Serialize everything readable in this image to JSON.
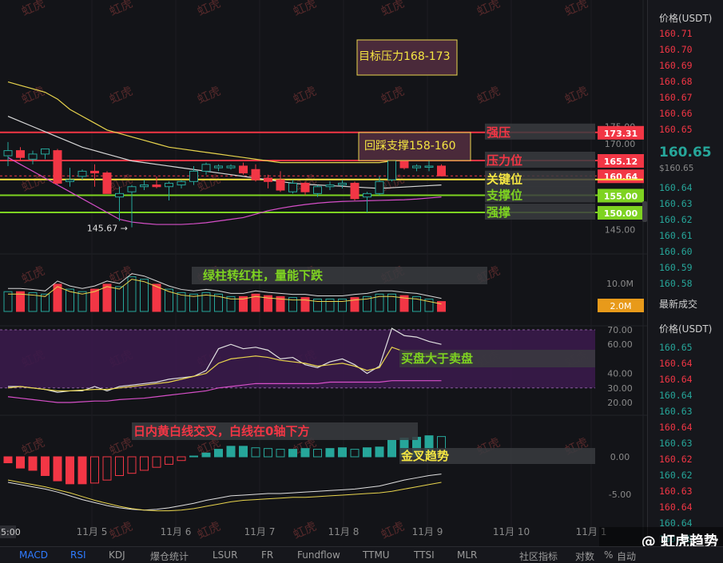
{
  "chart_data": {
    "type": "candlestick",
    "x_ticks": [
      "11月 5",
      "11月 6",
      "11月 7",
      "11月 8",
      "11月 9",
      "11月 10",
      "11月 1"
    ],
    "x_tick_first_partial": "5:00",
    "price_axis": {
      "ticks": [
        175.0,
        170.0,
        145.0
      ],
      "range": [
        140,
        180
      ]
    },
    "candles": [
      {
        "o": 166.5,
        "h": 170.5,
        "l": 163.5,
        "c": 168.0
      },
      {
        "o": 168.0,
        "h": 169.0,
        "l": 165.0,
        "c": 166.0
      },
      {
        "o": 165.5,
        "h": 168.0,
        "l": 164.0,
        "c": 167.0
      },
      {
        "o": 167.0,
        "h": 168.5,
        "l": 165.5,
        "c": 168.5
      },
      {
        "o": 168.0,
        "h": 168.5,
        "l": 158.0,
        "c": 158.5
      },
      {
        "o": 159.0,
        "h": 163.0,
        "l": 157.5,
        "c": 159.5
      },
      {
        "o": 160.5,
        "h": 162.5,
        "l": 159.5,
        "c": 162.0
      },
      {
        "o": 162.0,
        "h": 164.0,
        "l": 157.5,
        "c": 161.5
      },
      {
        "o": 161.5,
        "h": 162.0,
        "l": 155.5,
        "c": 155.5
      },
      {
        "o": 154.5,
        "h": 157.5,
        "l": 147.5,
        "c": 155.5
      },
      {
        "o": 156.0,
        "h": 158.0,
        "l": 145.67,
        "c": 157.5
      },
      {
        "o": 157.5,
        "h": 159.5,
        "l": 156.5,
        "c": 158.0
      },
      {
        "o": 158.0,
        "h": 160.5,
        "l": 157.0,
        "c": 157.5
      },
      {
        "o": 157.5,
        "h": 159.0,
        "l": 153.5,
        "c": 158.5
      },
      {
        "o": 158.0,
        "h": 159.5,
        "l": 157.0,
        "c": 159.0
      },
      {
        "o": 159.0,
        "h": 163.5,
        "l": 158.0,
        "c": 162.0
      },
      {
        "o": 162.0,
        "h": 164.5,
        "l": 161.0,
        "c": 164.0
      },
      {
        "o": 163.0,
        "h": 164.0,
        "l": 162.0,
        "c": 163.5
      },
      {
        "o": 163.0,
        "h": 164.0,
        "l": 162.5,
        "c": 163.5
      },
      {
        "o": 163.5,
        "h": 164.5,
        "l": 161.0,
        "c": 161.5
      },
      {
        "o": 162.5,
        "h": 164.0,
        "l": 159.0,
        "c": 159.5
      },
      {
        "o": 160.0,
        "h": 161.0,
        "l": 157.0,
        "c": 159.0
      },
      {
        "o": 159.5,
        "h": 162.0,
        "l": 156.0,
        "c": 156.5
      },
      {
        "o": 156.0,
        "h": 159.5,
        "l": 155.5,
        "c": 158.5
      },
      {
        "o": 158.5,
        "h": 159.0,
        "l": 155.0,
        "c": 156.0
      },
      {
        "o": 155.5,
        "h": 158.0,
        "l": 154.5,
        "c": 157.5
      },
      {
        "o": 157.5,
        "h": 159.0,
        "l": 156.5,
        "c": 158.0
      },
      {
        "o": 158.0,
        "h": 159.5,
        "l": 157.0,
        "c": 158.5
      },
      {
        "o": 158.5,
        "h": 159.0,
        "l": 153.5,
        "c": 154.0
      },
      {
        "o": 154.5,
        "h": 156.0,
        "l": 150.0,
        "c": 155.5
      },
      {
        "o": 155.5,
        "h": 160.5,
        "l": 155.0,
        "c": 159.0
      },
      {
        "o": 159.5,
        "h": 167.0,
        "l": 159.0,
        "c": 166.5
      },
      {
        "o": 166.5,
        "h": 167.5,
        "l": 162.5,
        "c": 163.0
      },
      {
        "o": 163.0,
        "h": 164.0,
        "l": 162.0,
        "c": 163.5
      },
      {
        "o": 163.5,
        "h": 165.5,
        "l": 162.0,
        "c": 163.5
      },
      {
        "o": 163.5,
        "h": 164.0,
        "l": 160.5,
        "c": 160.64
      }
    ],
    "ma_series": [
      {
        "color": "#e8d44d",
        "values": [
          188,
          187,
          186,
          185,
          183,
          180,
          178,
          176,
          174,
          173,
          172,
          171,
          170,
          169,
          168.5,
          168,
          167.5,
          167,
          166.5,
          166,
          165.5,
          165,
          164.5,
          164.5,
          164.5,
          164.5,
          164.5,
          164.5,
          164.5,
          164.5,
          164.5,
          165,
          165.5,
          166,
          166.5,
          166.8
        ]
      },
      {
        "color": "#d8d8d8",
        "values": [
          178,
          176.5,
          175,
          173.5,
          172,
          170.5,
          169,
          168,
          167,
          166,
          165,
          164.5,
          164,
          163.5,
          163,
          162.5,
          162,
          161.5,
          161,
          160.5,
          160,
          159.5,
          159,
          158.5,
          158.2,
          158,
          157.8,
          157.6,
          157.4,
          157.2,
          157,
          157.2,
          157.4,
          157.6,
          157.8,
          158
        ]
      },
      {
        "color": "#d64fc8",
        "values": [
          166,
          164,
          162,
          160,
          158,
          156,
          154,
          152,
          150,
          148,
          147.2,
          146.8,
          146.5,
          146.5,
          146.5,
          146.7,
          147,
          147.5,
          148,
          148.5,
          149.5,
          150.5,
          151.2,
          151.8,
          152.3,
          152.7,
          153,
          153.2,
          153.3,
          153.4,
          153.5,
          153.6,
          153.7,
          153.9,
          154.2,
          154.5
        ]
      }
    ],
    "volume": {
      "axis_label": "10.0M",
      "current_label": "2.0M",
      "values": [
        4,
        4,
        3.8,
        3.5,
        5.5,
        4.5,
        4,
        4.5,
        5.5,
        5,
        7,
        6.5,
        5.5,
        4.5,
        3.8,
        3.5,
        3.8,
        3.5,
        3,
        3,
        3.5,
        3.2,
        3,
        2.8,
        2.8,
        2.5,
        2.5,
        2.5,
        2.8,
        3,
        3.5,
        3.5,
        3.2,
        3,
        2.5,
        2
      ]
    },
    "rsi": {
      "ticks": [
        70.0,
        60.0,
        40.0,
        30.0,
        20.0
      ],
      "range": [
        10,
        80
      ],
      "line1": [
        31,
        31,
        30,
        29,
        27,
        28,
        28,
        31,
        28,
        31,
        32,
        33,
        34,
        36,
        37,
        38,
        42,
        57,
        60,
        57,
        58,
        56,
        50,
        51,
        46,
        44,
        48,
        50,
        46,
        40,
        45,
        71,
        66,
        65,
        62,
        60
      ],
      "line2": [
        30,
        31,
        30,
        29,
        28,
        28,
        28.5,
        29,
        29,
        30,
        31,
        32,
        33,
        34,
        36,
        38,
        40,
        47,
        50,
        51,
        52,
        51,
        49,
        48,
        47,
        45,
        46,
        47,
        45,
        42,
        44,
        58,
        55,
        54,
        53,
        52
      ],
      "line3": [
        24,
        23,
        22,
        21,
        20,
        20,
        20.5,
        21,
        21,
        22,
        22.5,
        23,
        24,
        25,
        26,
        27,
        28,
        30,
        31,
        32,
        33,
        33,
        33,
        33,
        33,
        33,
        34,
        34,
        34,
        34,
        34,
        35,
        35,
        35,
        35,
        35
      ]
    },
    "macd": {
      "ticks": [
        "0.00",
        "-5.00"
      ],
      "range": [
        -8,
        5
      ],
      "hist": [
        -0.8,
        -1.5,
        -1.8,
        -2.5,
        -3.2,
        -3.6,
        -3.6,
        -3.5,
        -3.1,
        -2.5,
        -2.2,
        -1.8,
        -1.4,
        -1.0,
        -0.5,
        0.1,
        0.5,
        1.0,
        1.4,
        1.4,
        1.2,
        1.1,
        1.0,
        1.0,
        1.1,
        1.0,
        1.1,
        1.2,
        1.0,
        1.2,
        1.3,
        2.2,
        2.5,
        2.6,
        2.8,
        2.7
      ],
      "dif": [
        -3.4,
        -3.7,
        -4.0,
        -4.3,
        -4.7,
        -5.2,
        -5.7,
        -6.1,
        -6.5,
        -6.8,
        -7.0,
        -7.1,
        -7.0,
        -6.8,
        -6.5,
        -6.2,
        -5.8,
        -5.5,
        -5.2,
        -5.1,
        -5.0,
        -4.9,
        -4.9,
        -4.8,
        -4.7,
        -4.6,
        -4.5,
        -4.4,
        -4.3,
        -4.1,
        -3.9,
        -3.5,
        -3.1,
        -2.8,
        -2.5,
        -2.3
      ],
      "dea": [
        -3.1,
        -3.4,
        -3.7,
        -4.0,
        -4.4,
        -4.8,
        -5.3,
        -5.8,
        -6.2,
        -6.6,
        -6.9,
        -7.1,
        -7.2,
        -7.2,
        -7.1,
        -6.9,
        -6.6,
        -6.3,
        -6.0,
        -5.8,
        -5.7,
        -5.6,
        -5.5,
        -5.4,
        -5.4,
        -5.3,
        -5.2,
        -5.1,
        -5.0,
        -4.9,
        -4.8,
        -4.6,
        -4.3,
        -4.0,
        -3.7,
        -3.4
      ]
    },
    "levels": [
      {
        "price": 173.31,
        "label": "173.31",
        "color": "#f23645",
        "name": "强压",
        "name_color": "#f23645"
      },
      {
        "price": 165.12,
        "label": "165.12",
        "color": "#f23645",
        "name": "压力位",
        "name_color": "#f23645"
      },
      {
        "price": 160.64,
        "label": "160.64",
        "color": "#f23645",
        "name": "",
        "name_color": "#f23645"
      },
      {
        "price": 159.6,
        "label": "",
        "color": "#f5e642",
        "name": "关键位",
        "name_color": "#f5e642"
      },
      {
        "price": 155.0,
        "label": "155.00",
        "color": "#7ed321",
        "name": "支撑位",
        "name_color": "#7ed321"
      },
      {
        "price": 150.0,
        "label": "150.00",
        "color": "#7ed321",
        "name": "强撑",
        "name_color": "#7ed321"
      }
    ],
    "annotations": {
      "target_box": "目标压力168-173",
      "pullback_box": "回踩支撑158-160",
      "low_label": "145.67",
      "volume_note": "绿柱转红柱，量能下跌",
      "rsi_note": "买盘大于卖盘",
      "macd_note": "日内黄白线交叉，白线在0轴下方",
      "macd_trend": "金叉趋势"
    },
    "watermark": "虹虎"
  },
  "orderbook": {
    "header": "价格(USDT)",
    "asks": [
      "160.71",
      "160.70",
      "160.69",
      "160.68",
      "160.67",
      "160.66",
      "160.65"
    ],
    "last_price": "160.65",
    "mark_price": "$160.65",
    "bids": [
      "160.64",
      "160.63",
      "160.62",
      "160.61",
      "160.60",
      "160.59",
      "160.58"
    ],
    "trades_title": "最新成交",
    "trades_header": "价格(USDT)",
    "trades": [
      {
        "p": "160.65",
        "side": "bid"
      },
      {
        "p": "160.64",
        "side": "ask"
      },
      {
        "p": "160.64",
        "side": "ask"
      },
      {
        "p": "160.64",
        "side": "bid"
      },
      {
        "p": "160.63",
        "side": "bid"
      },
      {
        "p": "160.64",
        "side": "ask"
      },
      {
        "p": "160.63",
        "side": "bid"
      },
      {
        "p": "160.62",
        "side": "ask"
      },
      {
        "p": "160.62",
        "side": "bid"
      },
      {
        "p": "160.63",
        "side": "ask"
      },
      {
        "p": "160.64",
        "side": "ask"
      },
      {
        "p": "160.64",
        "side": "bid"
      },
      {
        "p": "160.65",
        "side": "bid"
      },
      {
        "p": "160.65",
        "side": "bid"
      },
      {
        "p": "160.64",
        "side": "ask"
      }
    ]
  },
  "toolbar": {
    "items": [
      "MACD",
      "RSI",
      "KDJ",
      "爆仓统计",
      "LSUR",
      "FR",
      "Fundflow",
      "TTMU",
      "TTSI",
      "MLR"
    ],
    "right_items": [
      "社区指标",
      "对数",
      "%",
      "自动"
    ]
  },
  "brand": "@ 虹虎趋势"
}
